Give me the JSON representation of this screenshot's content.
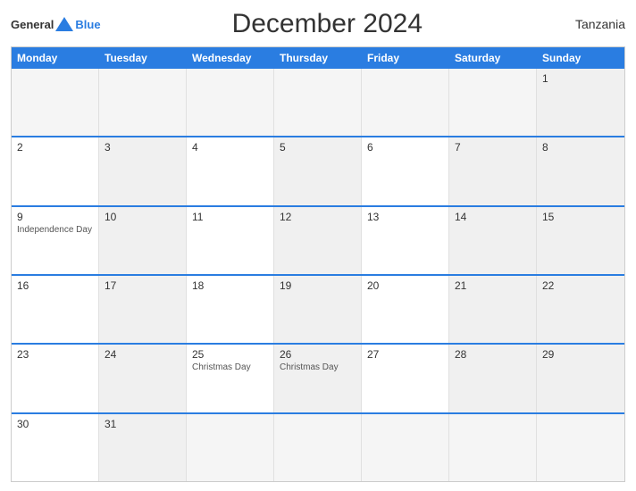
{
  "header": {
    "logo_general": "General",
    "logo_blue": "Blue",
    "title": "December 2024",
    "country": "Tanzania"
  },
  "calendar": {
    "days_of_week": [
      "Monday",
      "Tuesday",
      "Wednesday",
      "Thursday",
      "Friday",
      "Saturday",
      "Sunday"
    ],
    "weeks": [
      [
        {
          "day": "",
          "holiday": "",
          "empty": true
        },
        {
          "day": "",
          "holiday": "",
          "empty": true
        },
        {
          "day": "",
          "holiday": "",
          "empty": true
        },
        {
          "day": "",
          "holiday": "",
          "empty": true
        },
        {
          "day": "",
          "holiday": "",
          "empty": true
        },
        {
          "day": "",
          "holiday": "",
          "empty": true
        },
        {
          "day": "1",
          "holiday": "",
          "shaded": true
        }
      ],
      [
        {
          "day": "2",
          "holiday": "",
          "shaded": false
        },
        {
          "day": "3",
          "holiday": "",
          "shaded": true
        },
        {
          "day": "4",
          "holiday": "",
          "shaded": false
        },
        {
          "day": "5",
          "holiday": "",
          "shaded": true
        },
        {
          "day": "6",
          "holiday": "",
          "shaded": false
        },
        {
          "day": "7",
          "holiday": "",
          "shaded": true
        },
        {
          "day": "8",
          "holiday": "",
          "shaded": true
        }
      ],
      [
        {
          "day": "9",
          "holiday": "Independence Day",
          "shaded": false
        },
        {
          "day": "10",
          "holiday": "",
          "shaded": true
        },
        {
          "day": "11",
          "holiday": "",
          "shaded": false
        },
        {
          "day": "12",
          "holiday": "",
          "shaded": true
        },
        {
          "day": "13",
          "holiday": "",
          "shaded": false
        },
        {
          "day": "14",
          "holiday": "",
          "shaded": true
        },
        {
          "day": "15",
          "holiday": "",
          "shaded": true
        }
      ],
      [
        {
          "day": "16",
          "holiday": "",
          "shaded": false
        },
        {
          "day": "17",
          "holiday": "",
          "shaded": true
        },
        {
          "day": "18",
          "holiday": "",
          "shaded": false
        },
        {
          "day": "19",
          "holiday": "",
          "shaded": true
        },
        {
          "day": "20",
          "holiday": "",
          "shaded": false
        },
        {
          "day": "21",
          "holiday": "",
          "shaded": true
        },
        {
          "day": "22",
          "holiday": "",
          "shaded": true
        }
      ],
      [
        {
          "day": "23",
          "holiday": "",
          "shaded": false
        },
        {
          "day": "24",
          "holiday": "",
          "shaded": true
        },
        {
          "day": "25",
          "holiday": "Christmas Day",
          "shaded": false
        },
        {
          "day": "26",
          "holiday": "Christmas Day",
          "shaded": true
        },
        {
          "day": "27",
          "holiday": "",
          "shaded": false
        },
        {
          "day": "28",
          "holiday": "",
          "shaded": true
        },
        {
          "day": "29",
          "holiday": "",
          "shaded": true
        }
      ],
      [
        {
          "day": "30",
          "holiday": "",
          "shaded": false
        },
        {
          "day": "31",
          "holiday": "",
          "shaded": true
        },
        {
          "day": "",
          "holiday": "",
          "empty": true
        },
        {
          "day": "",
          "holiday": "",
          "empty": true
        },
        {
          "day": "",
          "holiday": "",
          "empty": true
        },
        {
          "day": "",
          "holiday": "",
          "empty": true
        },
        {
          "day": "",
          "holiday": "",
          "empty": true
        }
      ]
    ]
  }
}
